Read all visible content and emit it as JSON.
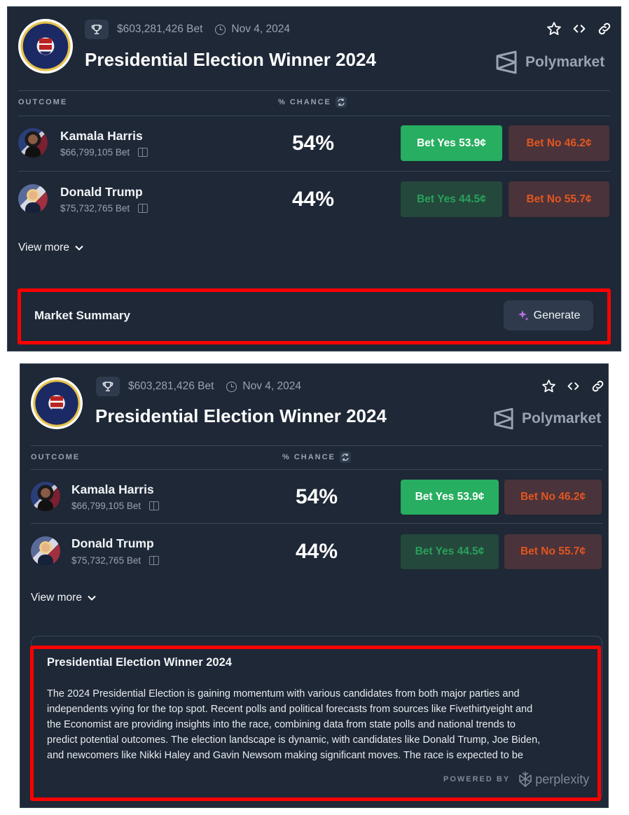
{
  "market": {
    "volume": "$603,281,426 Bet",
    "date": "Nov 4, 2024",
    "title": "Presidential Election Winner 2024",
    "brand": "Polymarket",
    "col_outcome": "OUTCOME",
    "col_chance": "% CHANCE",
    "outcomes": [
      {
        "name": "Kamala Harris",
        "bet": "$66,799,105 Bet",
        "chance": "54%",
        "yes": "Bet Yes 53.9¢",
        "no": "Bet No 46.2¢"
      },
      {
        "name": "Donald Trump",
        "bet": "$75,732,765 Bet",
        "chance": "44%",
        "yes": "Bet Yes 44.5¢",
        "no": "Bet No 55.7¢"
      }
    ],
    "view_more": "View more"
  },
  "summary_collapsed": {
    "label": "Market Summary",
    "button": "Generate"
  },
  "summary_expanded": {
    "title": "Presidential Election Winner 2024",
    "body": [
      "The 2024 Presidential Election is gaining momentum with various candidates from both major parties and",
      "independents vying for the top spot. Recent polls and political forecasts from sources like Fivethirtyeight and",
      "the Economist are providing insights into the race, combining data from state polls and national trends to",
      "predict potential outcomes. The election landscape is dynamic, with candidates like Donald Trump, Joe Biden,",
      "and newcomers like Nikki Haley and Gavin Newsom making significant moves. The race is expected to be"
    ],
    "powered_by": "POWERED BY",
    "provider": "perplexity"
  },
  "colors": {
    "panel_bg": "#1e2836",
    "yes_active": "#27ae60",
    "yes_muted": "#24483c",
    "no_bg": "#4a333b",
    "no_text": "#e2561f",
    "highlight": "#ff0000"
  }
}
